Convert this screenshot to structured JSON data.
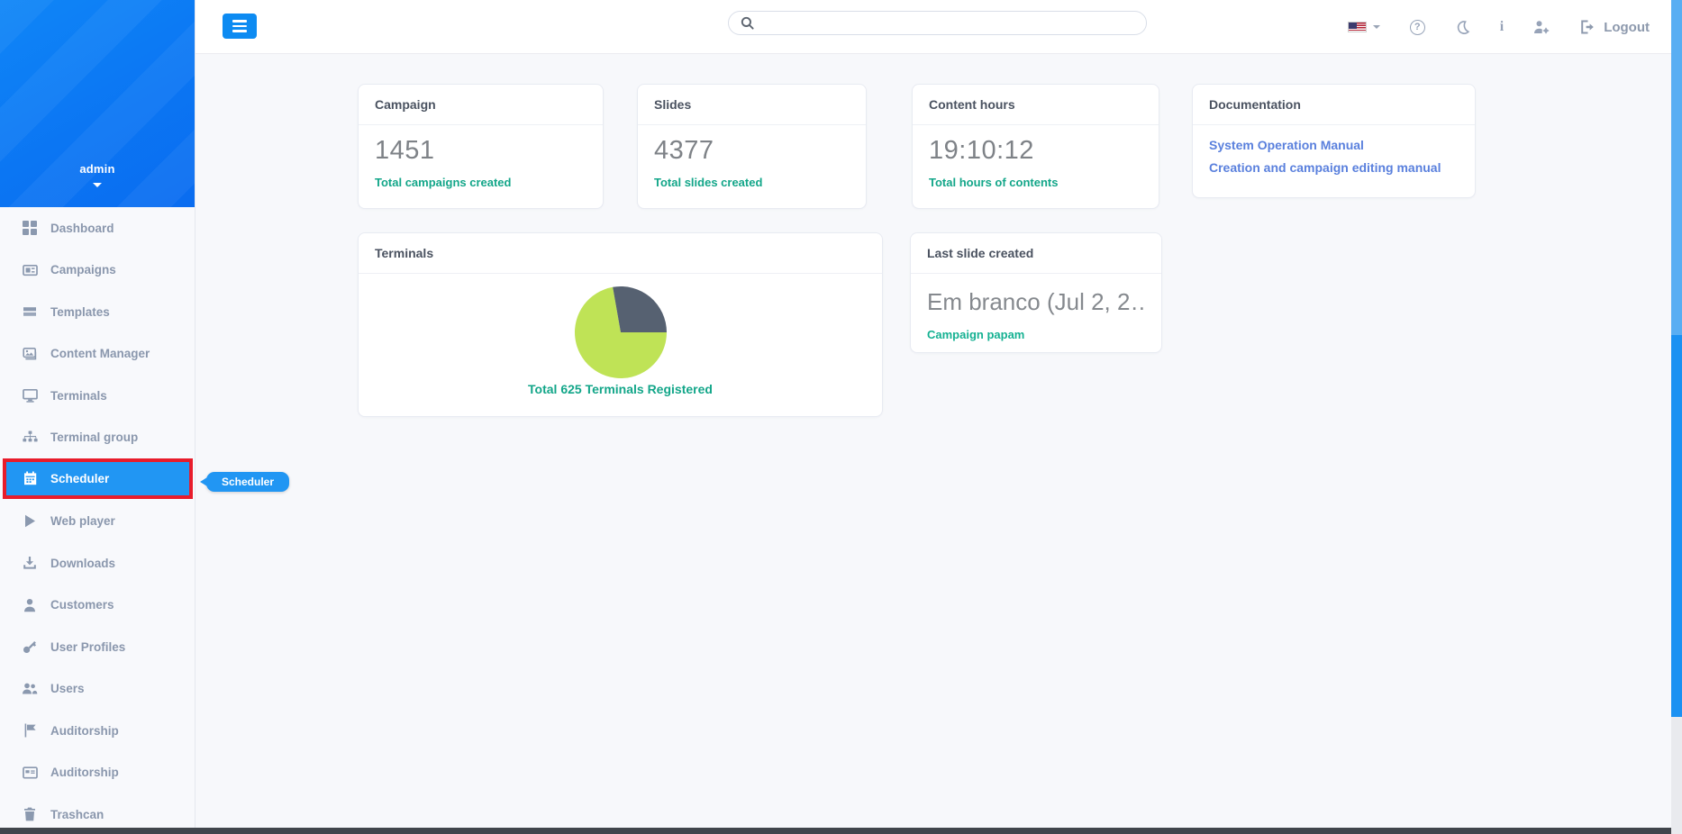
{
  "sidebar": {
    "user": "admin",
    "items": [
      {
        "label": "Dashboard",
        "icon": "dashboard-grid-icon"
      },
      {
        "label": "Campaigns",
        "icon": "newspaper-icon"
      },
      {
        "label": "Templates",
        "icon": "template-icon"
      },
      {
        "label": "Content Manager",
        "icon": "images-icon"
      },
      {
        "label": "Terminals",
        "icon": "monitor-icon"
      },
      {
        "label": "Terminal group",
        "icon": "sitemap-icon"
      },
      {
        "label": "Scheduler",
        "icon": "calendar-icon"
      },
      {
        "label": "Web player",
        "icon": "play-icon"
      },
      {
        "label": "Downloads",
        "icon": "download-icon"
      },
      {
        "label": "Customers",
        "icon": "user-icon"
      },
      {
        "label": "User Profiles",
        "icon": "key-icon"
      },
      {
        "label": "Users",
        "icon": "users-icon"
      },
      {
        "label": "Auditorship",
        "icon": "flag-icon"
      },
      {
        "label": "Auditorship",
        "icon": "card-icon"
      },
      {
        "label": "Trashcan",
        "icon": "trash-icon"
      }
    ],
    "active_item": "Scheduler",
    "annotation": {
      "tooltip_label": "Scheduler",
      "highlight_color": "#e81c2b"
    }
  },
  "topbar": {
    "search_placeholder": "",
    "search_value": "",
    "language_flag": "us-flag",
    "logout_label": "Logout",
    "icons": [
      "us-flag",
      "help",
      "dark-mode-moon",
      "info",
      "user-settings",
      "logout"
    ]
  },
  "main": {
    "stats": [
      {
        "title": "Campaign",
        "value": "1451",
        "caption": "Total campaigns created"
      },
      {
        "title": "Slides",
        "value": "4377",
        "caption": "Total slides created"
      },
      {
        "title": "Content hours",
        "value": "19:10:12",
        "caption": "Total hours of contents"
      }
    ],
    "documentation": {
      "title": "Documentation",
      "links": [
        "System Operation Manual",
        "Creation and campaign editing manual"
      ]
    },
    "terminals": {
      "title": "Terminals",
      "caption": "Total 625 Terminals Registered"
    },
    "last_slide": {
      "title": "Last slide created",
      "value": "Em branco (Jul 2, 2…",
      "caption": "Campaign papam"
    }
  },
  "chart_data": {
    "type": "pie",
    "title": "Terminals",
    "caption": "Total 625 Terminals Registered",
    "total": 625,
    "legend": "none",
    "slices": [
      {
        "label": "segment-green",
        "color": "#bfe356",
        "percent": 71.4,
        "value_estimate": 446
      },
      {
        "label": "segment-dark",
        "color": "#566171",
        "percent": 28.6,
        "value_estimate": 179
      }
    ]
  },
  "colors": {
    "sidebar_hero_blue": "#0b76f3",
    "active_item_blue": "#2196f3",
    "annotation_red": "#e81c2b",
    "caption_green": "#13a689",
    "doc_link_blue": "#5a80dd",
    "pie_green": "#bfe356",
    "pie_dark": "#566171",
    "scrollbar_thumb": "#59aef3",
    "scrollbar_track": "#1b91f2"
  }
}
